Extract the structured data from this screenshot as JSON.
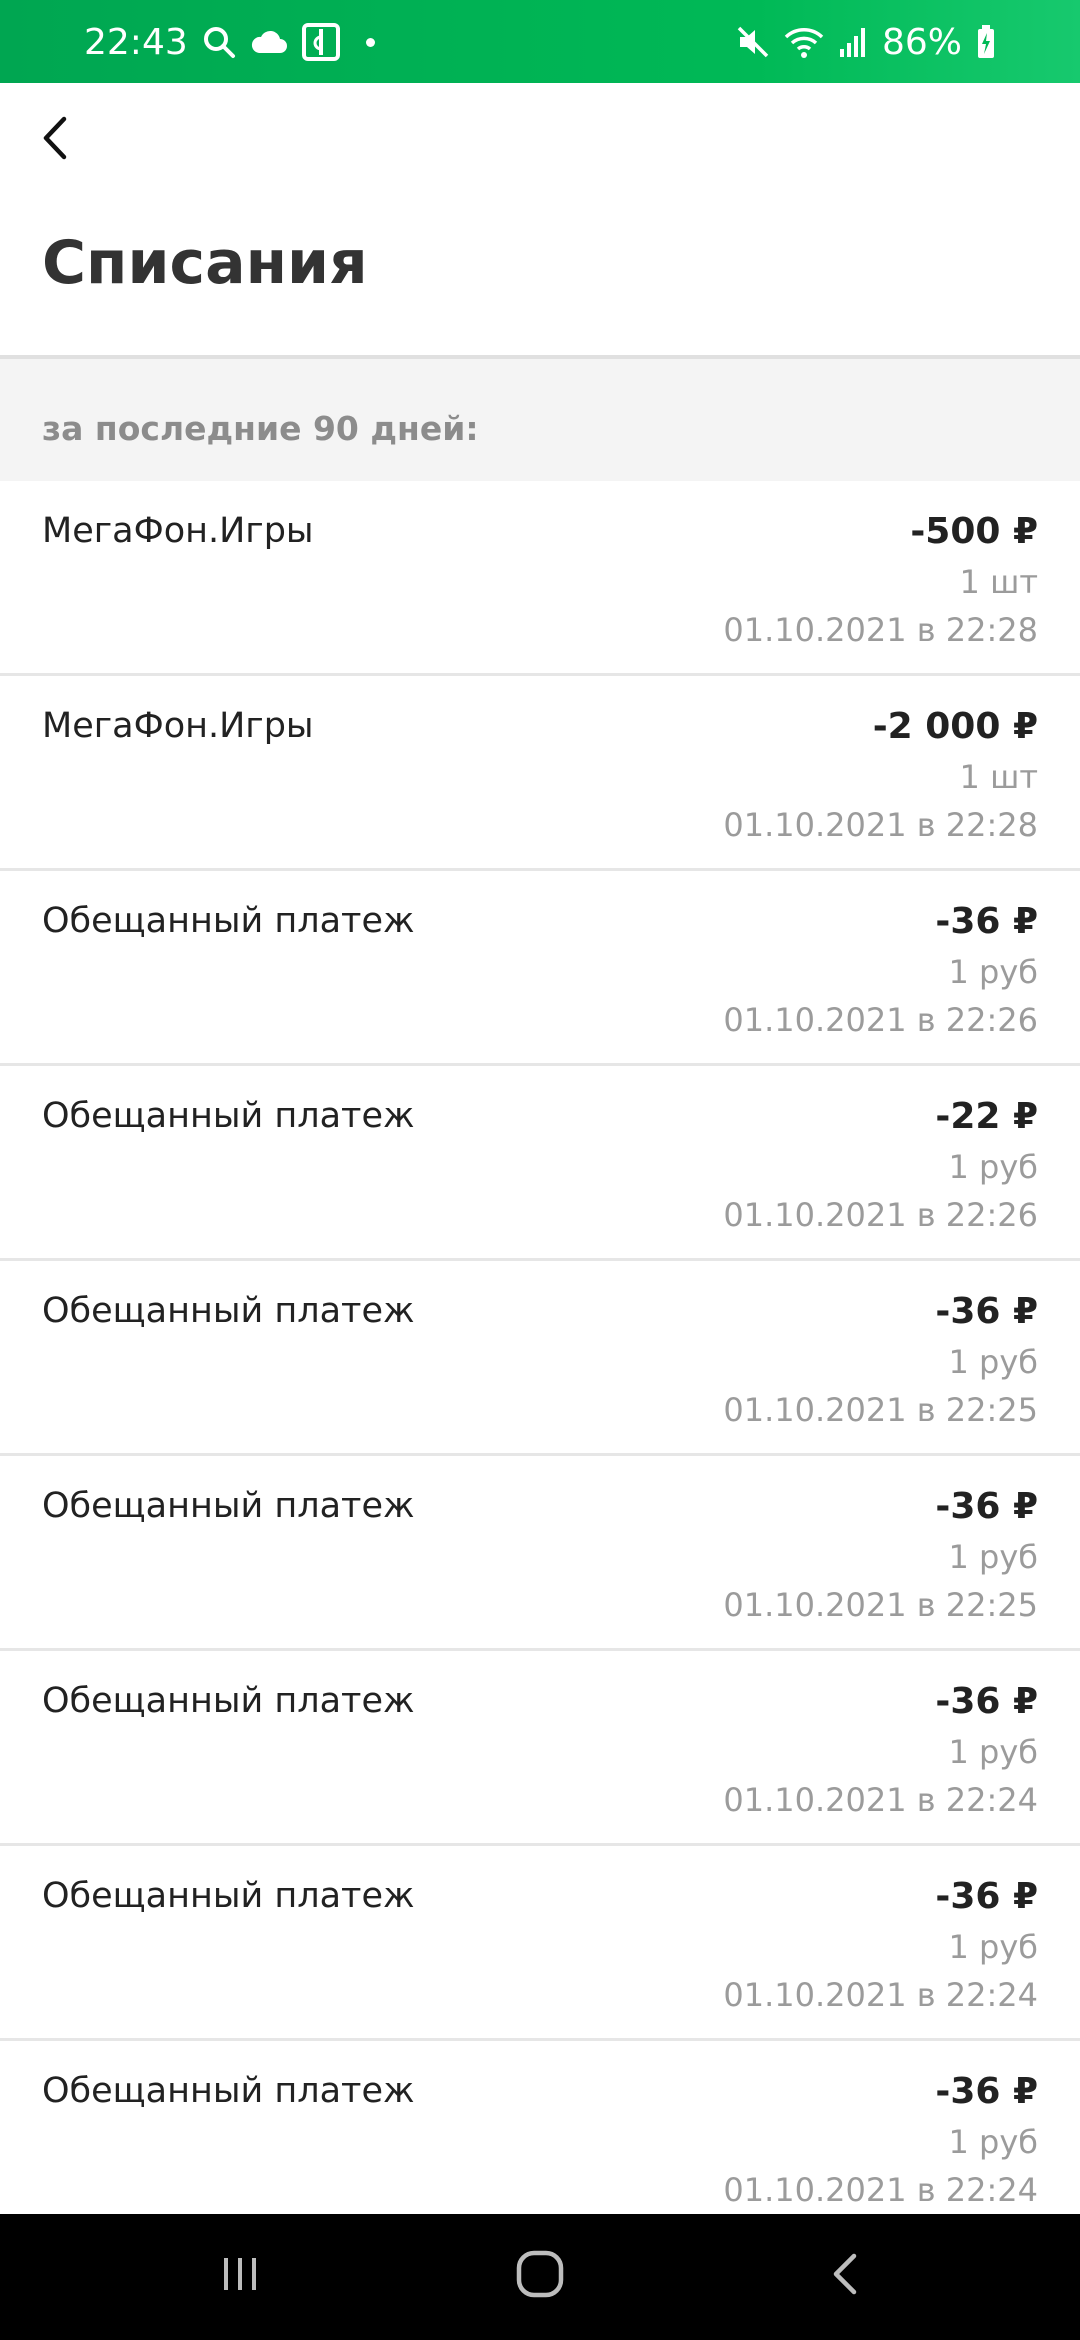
{
  "status_bar": {
    "time": "22:43",
    "battery_percent": "86%",
    "left_icons": [
      "search-icon",
      "cloud-icon",
      "app-notification-icon",
      "dot-icon"
    ],
    "right_icons": [
      "mute-icon",
      "wifi-icon",
      "signal-icon",
      "battery-charging-icon"
    ]
  },
  "header": {
    "title": "Списания",
    "back_icon": "chevron-left-icon"
  },
  "section": {
    "label": "за последние 90 дней:"
  },
  "transactions": [
    {
      "name": "МегаФон.Игры",
      "amount": "-500 ₽",
      "qty": "1 шт",
      "date": "01.10.2021 в 22:28"
    },
    {
      "name": "МегаФон.Игры",
      "amount": "-2 000 ₽",
      "qty": "1 шт",
      "date": "01.10.2021 в 22:28"
    },
    {
      "name": "Обещанный платеж",
      "amount": "-36 ₽",
      "qty": "1 руб",
      "date": "01.10.2021 в 22:26"
    },
    {
      "name": "Обещанный платеж",
      "amount": "-22 ₽",
      "qty": "1 руб",
      "date": "01.10.2021 в 22:26"
    },
    {
      "name": "Обещанный платеж",
      "amount": "-36 ₽",
      "qty": "1 руб",
      "date": "01.10.2021 в 22:25"
    },
    {
      "name": "Обещанный платеж",
      "amount": "-36 ₽",
      "qty": "1 руб",
      "date": "01.10.2021 в 22:25"
    },
    {
      "name": "Обещанный платеж",
      "amount": "-36 ₽",
      "qty": "1 руб",
      "date": "01.10.2021 в 22:24"
    },
    {
      "name": "Обещанный платеж",
      "amount": "-36 ₽",
      "qty": "1 руб",
      "date": "01.10.2021 в 22:24"
    },
    {
      "name": "Обещанный платеж",
      "amount": "-36 ₽",
      "qty": "1 руб",
      "date": "01.10.2021 в 22:24"
    }
  ],
  "nav_bar": {
    "buttons": [
      "recent-apps-icon",
      "home-icon",
      "back-icon"
    ]
  },
  "colors": {
    "brand_green": "#00b956",
    "text_primary": "#222222",
    "text_secondary": "#9b9b9b",
    "section_background": "#f4f4f4"
  }
}
